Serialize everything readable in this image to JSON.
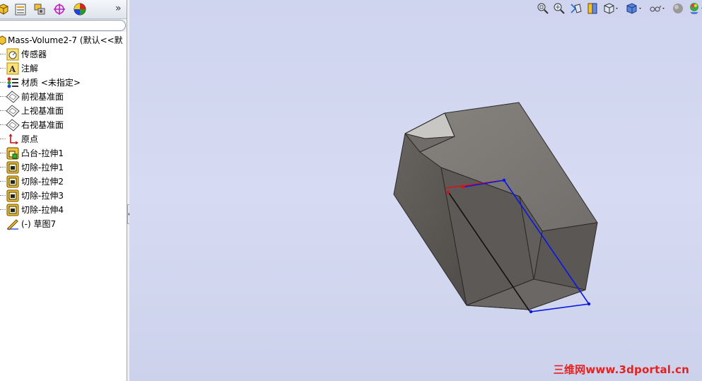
{
  "tabs": [
    {
      "name": "featuremanager-tab-icon"
    },
    {
      "name": "propertymanager-tab-icon"
    },
    {
      "name": "configurationmanager-tab-icon"
    },
    {
      "name": "dimxpert-tab-icon"
    },
    {
      "name": "display-manager-tab-icon"
    }
  ],
  "tabbar": {
    "more": "»"
  },
  "tree": {
    "root": "Mass-Volume2-7  (默认<<默",
    "items": [
      {
        "label": "传感器",
        "icon": "sensor-icon"
      },
      {
        "label": "注解",
        "icon": "annotation-icon"
      },
      {
        "label": "材质 <未指定>",
        "icon": "material-icon"
      },
      {
        "label": "前视基准面",
        "icon": "plane-icon"
      },
      {
        "label": "上视基准面",
        "icon": "plane-icon"
      },
      {
        "label": "右视基准面",
        "icon": "plane-icon"
      },
      {
        "label": "原点",
        "icon": "origin-icon"
      },
      {
        "label": "凸台-拉伸1",
        "icon": "boss-extrude-icon"
      },
      {
        "label": "切除-拉伸1",
        "icon": "cut-extrude-icon"
      },
      {
        "label": "切除-拉伸2",
        "icon": "cut-extrude-icon"
      },
      {
        "label": "切除-拉伸3",
        "icon": "cut-extrude-icon"
      },
      {
        "label": "切除-拉伸4",
        "icon": "cut-extrude-icon"
      },
      {
        "label": "(-) 草图7",
        "icon": "sketch-icon"
      }
    ]
  },
  "heads_up_toolbar": [
    "zoom-to-fit-icon",
    "zoom-to-area-icon",
    "previous-view-icon",
    "section-view-icon",
    "view-orientation-icon",
    "display-style-icon",
    "hide-show-items-icon",
    "edit-appearance-icon",
    "apply-scene-icon",
    "view-settings-icon"
  ],
  "colors": {
    "viewport_bg": "#d3d7f0",
    "solid_face_light": "#7b7875",
    "solid_face_mid": "#65625f",
    "solid_face_dark": "#55524f",
    "solid_top_highlight": "#c8c6c3",
    "sketch_blue": "#0a16e6",
    "sketch_red": "#e01010",
    "watermark": "#e8201e"
  },
  "watermark": "三维网www.3dportal.cn"
}
